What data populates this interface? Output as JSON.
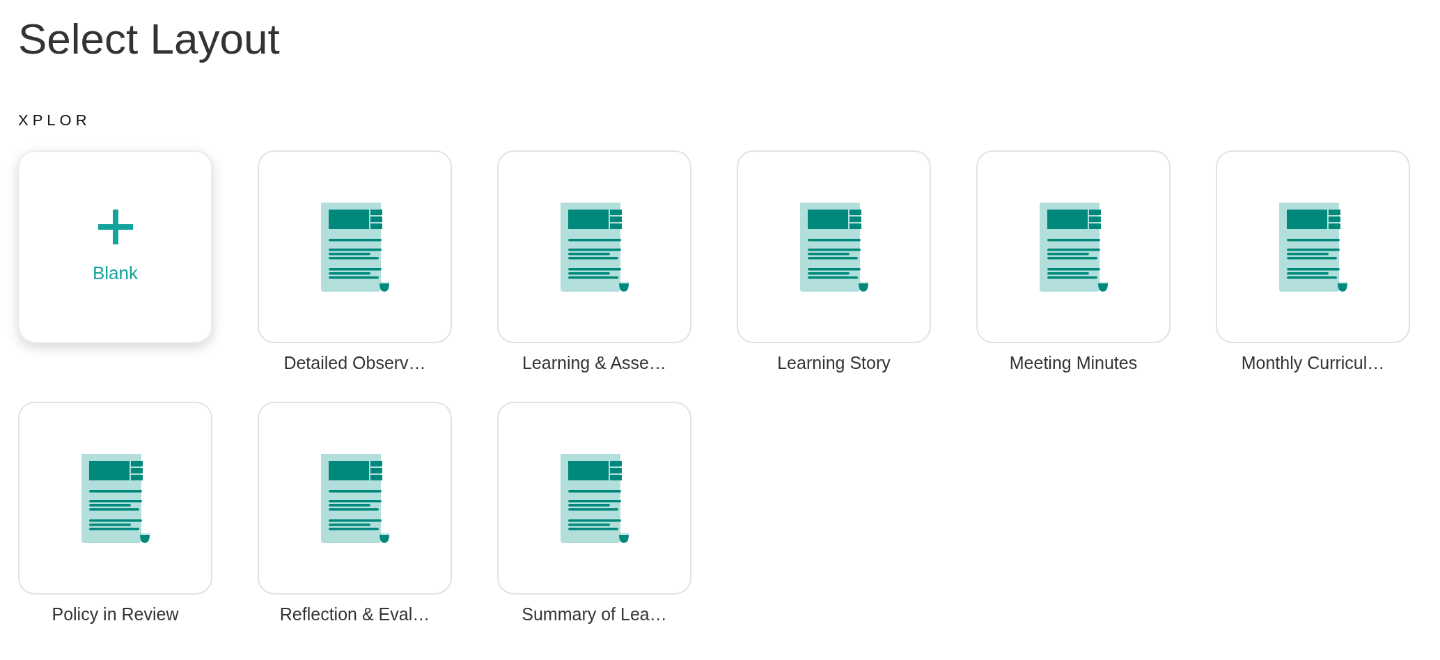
{
  "title": "Select Layout",
  "section": {
    "heading": "XPLOR",
    "layouts": [
      {
        "kind": "blank",
        "label": "Blank",
        "selected": true
      },
      {
        "kind": "template",
        "label": "Detailed Observ…",
        "selected": false
      },
      {
        "kind": "template",
        "label": "Learning & Asse…",
        "selected": false
      },
      {
        "kind": "template",
        "label": "Learning Story",
        "selected": false
      },
      {
        "kind": "template",
        "label": "Meeting Minutes",
        "selected": false
      },
      {
        "kind": "template",
        "label": "Monthly Curricul…",
        "selected": false
      },
      {
        "kind": "template",
        "label": "Policy in Review",
        "selected": false
      },
      {
        "kind": "template",
        "label": "Reflection & Eval…",
        "selected": false
      },
      {
        "kind": "template",
        "label": "Summary of Lea…",
        "selected": false
      }
    ]
  }
}
